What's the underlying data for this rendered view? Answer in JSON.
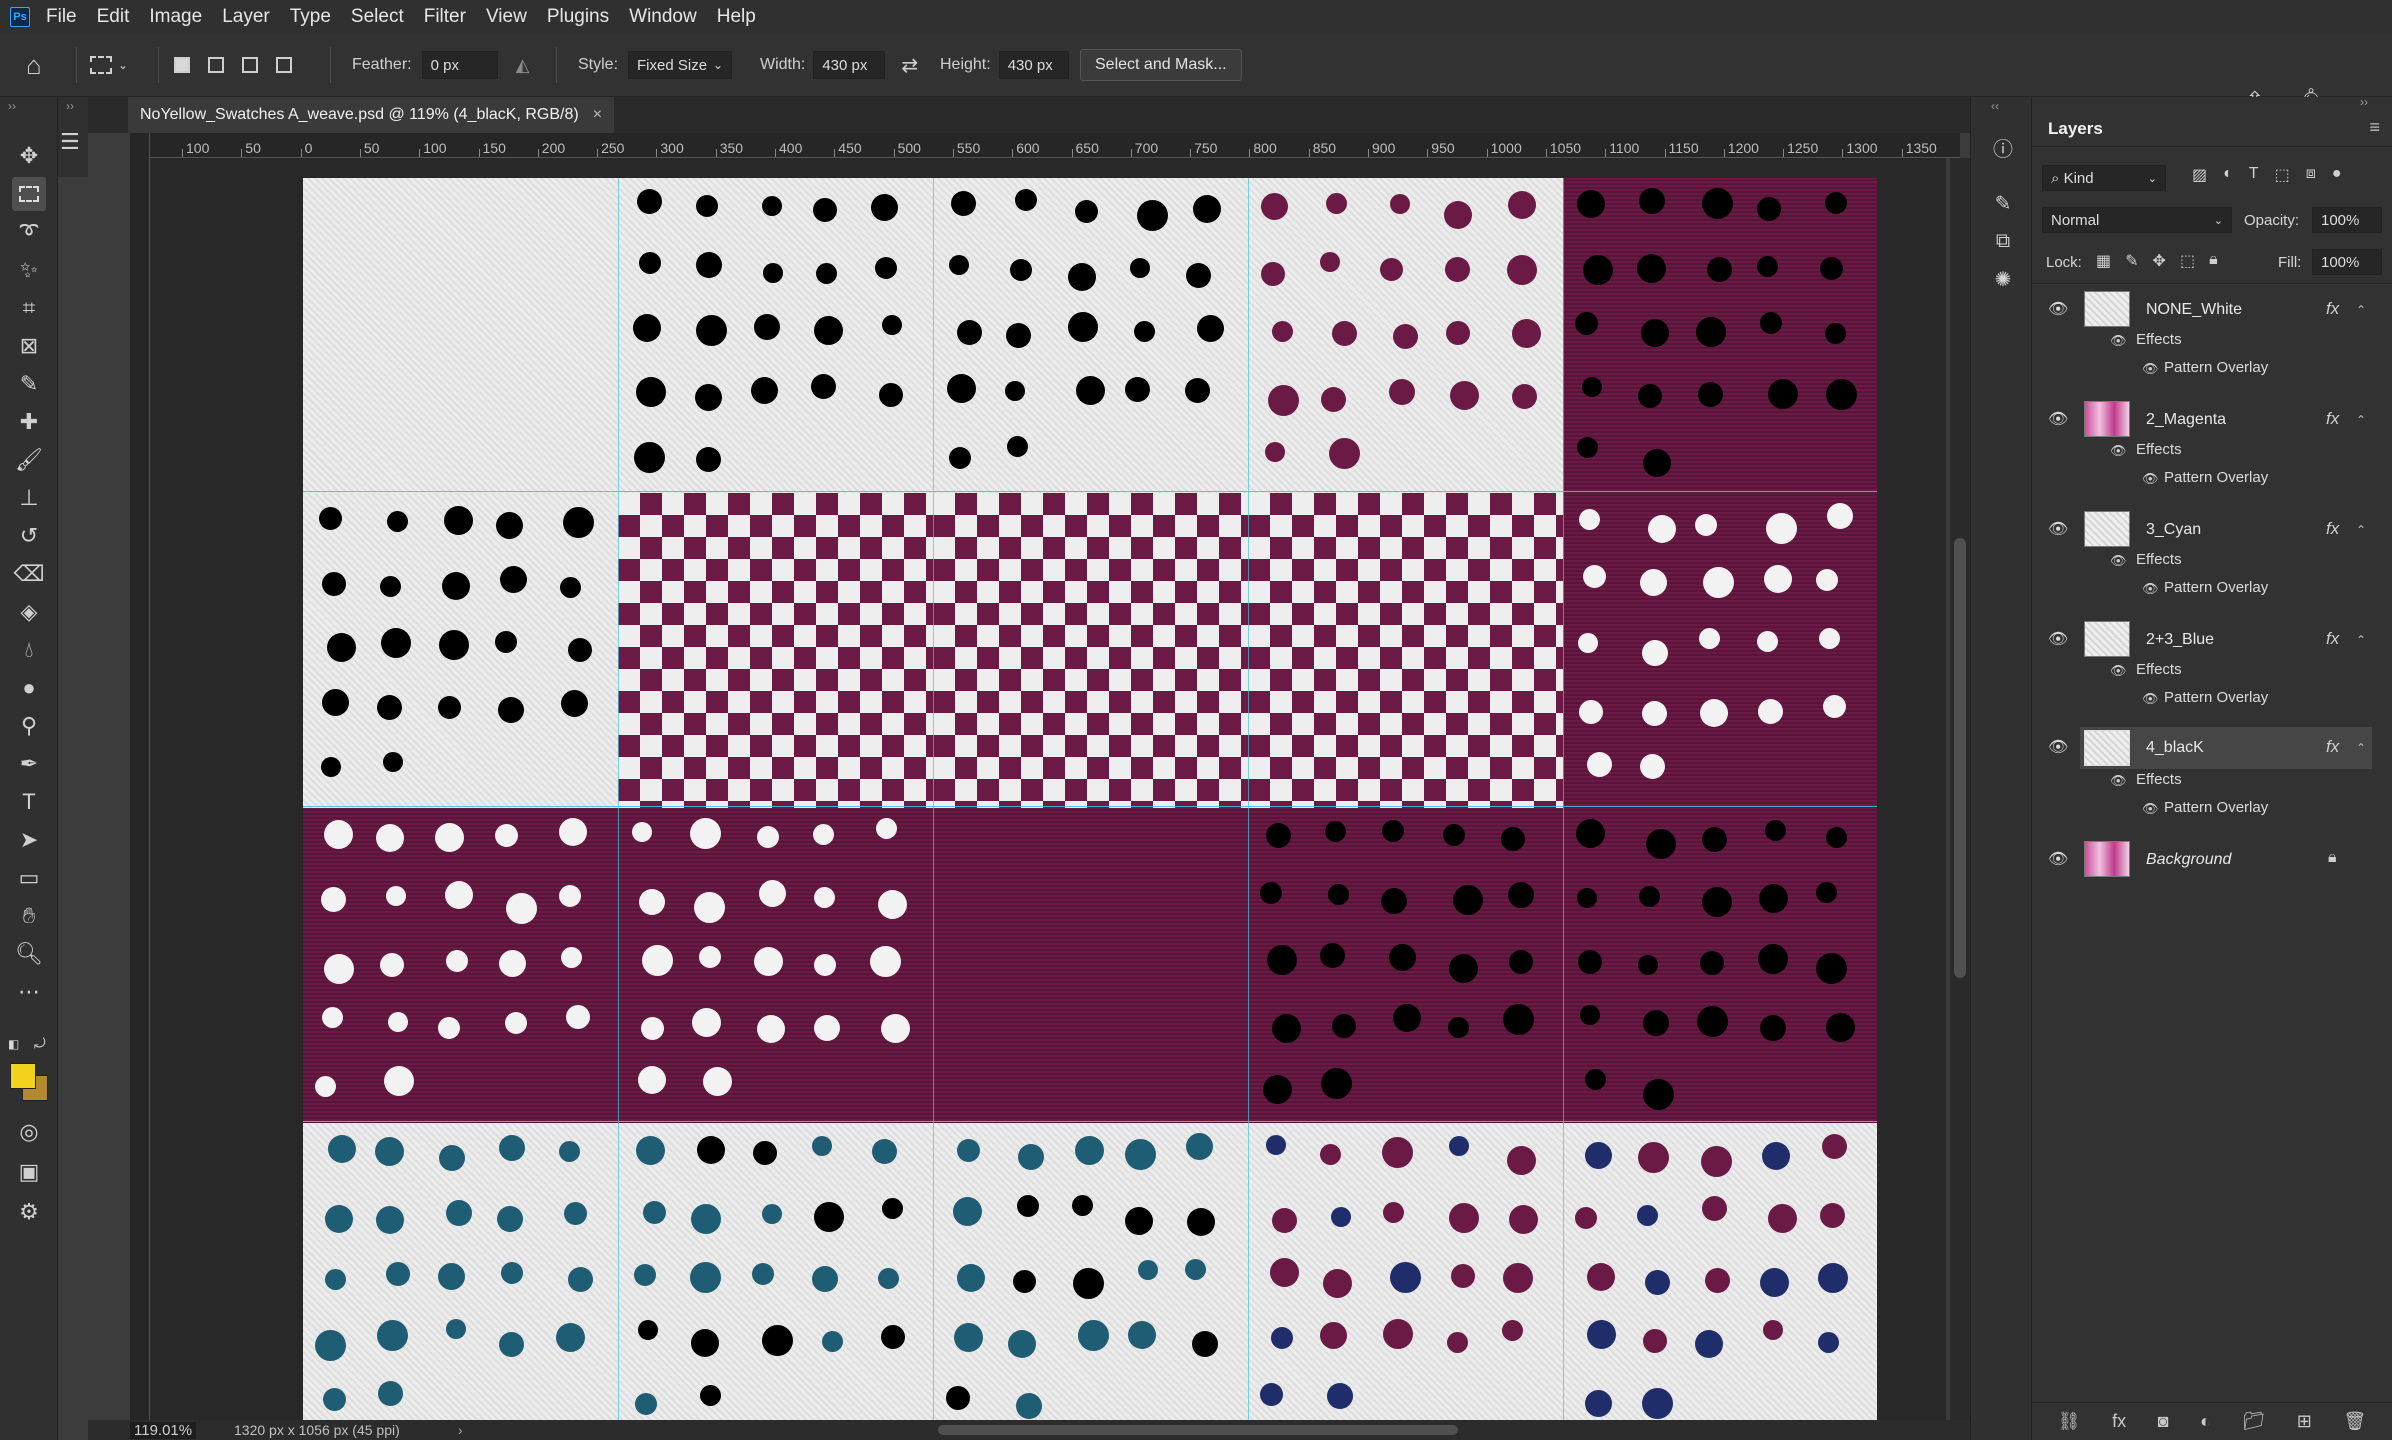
{
  "menu": {
    "items": [
      "File",
      "Edit",
      "Image",
      "Layer",
      "Type",
      "Select",
      "Filter",
      "View",
      "Plugins",
      "Window",
      "Help"
    ]
  },
  "options": {
    "feather_label": "Feather:",
    "feather_value": "0 px",
    "style_label": "Style:",
    "style_value": "Fixed Size",
    "width_label": "Width:",
    "width_value": "430 px",
    "height_label": "Height:",
    "height_value": "430 px",
    "mask_button": "Select and Mask..."
  },
  "document": {
    "tab_title": "NoYellow_Swatches A_weave.psd @ 119% (4_blacK, RGB/8)",
    "close_glyph": "×",
    "zoom": "119.01%",
    "info": "1320 px x 1056 px (45 ppi)",
    "ruler_labels": [
      "100",
      "50",
      "0",
      "50",
      "100",
      "150",
      "200",
      "250",
      "300",
      "350",
      "400",
      "450",
      "500",
      "550",
      "600",
      "650",
      "700",
      "750",
      "800",
      "850",
      "900",
      "950",
      "1000",
      "1050",
      "1100",
      "1150",
      "1200",
      "1250",
      "1300",
      "1350"
    ]
  },
  "colors": {
    "foreground": "#f3d21c",
    "background": "#b58a2e",
    "magenta": "#6b1a45",
    "cyan_dot": "#1f5d74",
    "guide": "#3fc6d6"
  },
  "layers_panel": {
    "title": "Layers",
    "kind_filter": "Kind",
    "blend_mode": "Normal",
    "opacity_label": "Opacity:",
    "opacity_value": "100%",
    "lock_label": "Lock:",
    "fill_label": "Fill:",
    "fill_value": "100%",
    "fx_glyph": "fx",
    "layers": [
      {
        "name": "NONE_White",
        "effects": "Effects",
        "effect": "Pattern Overlay"
      },
      {
        "name": "2_Magenta",
        "effects": "Effects",
        "effect": "Pattern Overlay"
      },
      {
        "name": "3_Cyan",
        "effects": "Effects",
        "effect": "Pattern Overlay"
      },
      {
        "name": "2+3_Blue",
        "effects": "Effects",
        "effect": "Pattern Overlay"
      },
      {
        "name": "4_blacK",
        "effects": "Effects",
        "effect": "Pattern Overlay"
      },
      {
        "name": "Background"
      }
    ]
  }
}
